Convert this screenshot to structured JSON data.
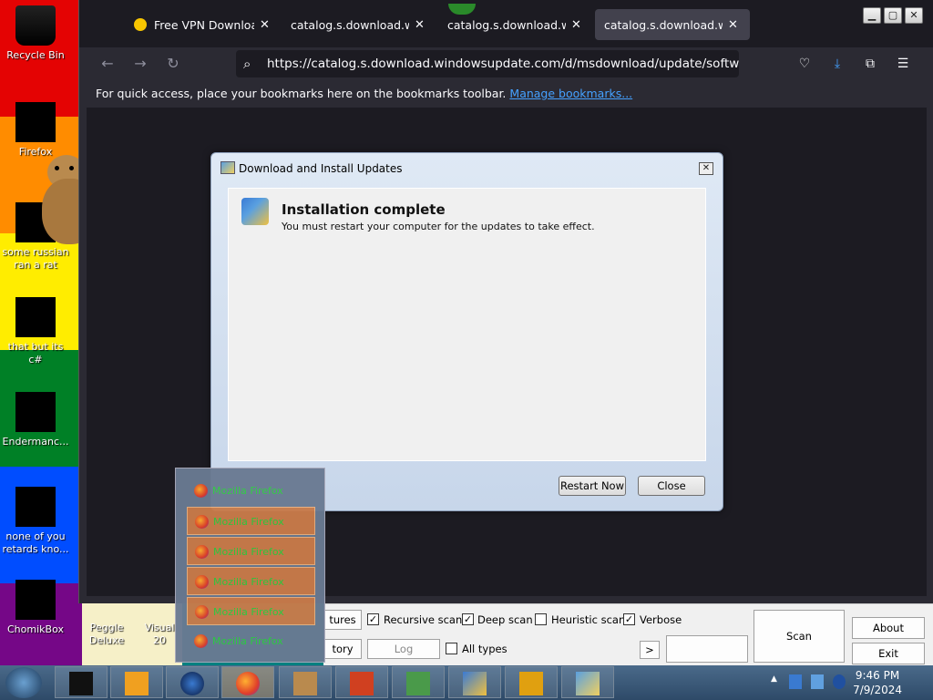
{
  "desktop": {
    "icons": [
      {
        "label": "Recycle Bin"
      },
      {
        "label": "Firefox"
      },
      {
        "label": "some russian ran a rat"
      },
      {
        "label": "that but its c#"
      },
      {
        "label": "Endermanc..."
      },
      {
        "label": "none of you retards kno..."
      },
      {
        "label": "ChomikBox"
      },
      {
        "label": "Peggle Deluxe"
      },
      {
        "label": "Visual 20"
      }
    ]
  },
  "browser": {
    "tabs": [
      {
        "title": "Free VPN Download f",
        "close": "✕"
      },
      {
        "title": "catalog.s.download.windo",
        "close": "✕"
      },
      {
        "title": "catalog.s.download.windo",
        "close": "✕"
      },
      {
        "title": "catalog.s.download.windo",
        "close": "✕"
      }
    ],
    "url": "https://catalog.s.download.windowsupdate.com/d/msdownload/update/software/se",
    "bookmarks_text": "For quick access, place your bookmarks here on the bookmarks toolbar.",
    "manage_bookmarks": "Manage bookmarks..."
  },
  "dialog": {
    "title": "Download and Install Updates",
    "heading": "Installation complete",
    "message": "You must restart your computer for the updates to take effect.",
    "restart_label": "Restart Now",
    "close_label": "Close"
  },
  "avapp": {
    "recursive_scan": "Recursive scan",
    "deep_scan": "Deep scan",
    "heuristic_scan": "Heuristic scan",
    "verbose": "Verbose",
    "all_types": "All types",
    "log": "Log",
    "tures": "tures",
    "tory": "tory",
    "scan": "Scan",
    "about": "About",
    "exit": "Exit",
    "arrow": ">",
    "check": "✓"
  },
  "popup": {
    "items": [
      "Mozilla Firefox",
      "Mozilla Firefox",
      "Mozilla Firefox",
      "Mozilla Firefox",
      "Mozilla Firefox",
      "Mozilla Firefox"
    ]
  },
  "taskbar": {
    "time": "9:46 PM",
    "date": "7/9/2024"
  }
}
